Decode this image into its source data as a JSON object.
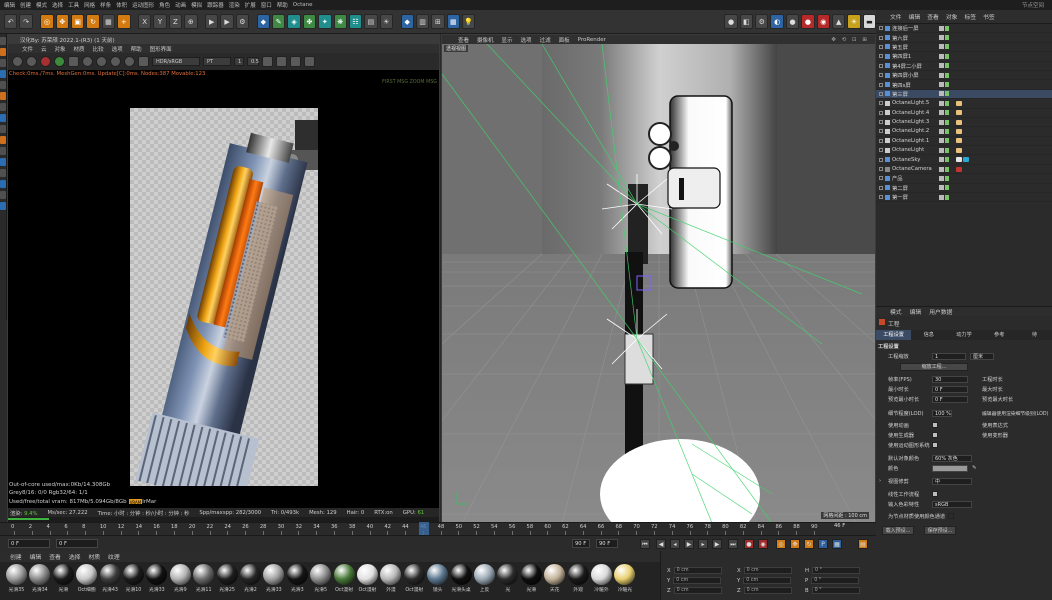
{
  "menubar": {
    "items": [
      "编辑",
      "创建",
      "模式",
      "选择",
      "工具",
      "网格",
      "样条",
      "体积",
      "运动图形",
      "角色",
      "动画",
      "模拟",
      "跟踪器",
      "渲染",
      "扩展",
      "窗口",
      "帮助",
      "Octane"
    ],
    "right": "节点空间"
  },
  "octane_viewer": {
    "title": "汉化By: 苏荣颀 2022.1-(R3) (1 天前)",
    "menu": [
      "文件",
      "云",
      "对象",
      "材质",
      "比较",
      "选项",
      "帮助",
      "图形界面"
    ],
    "color_space": "HDR/sRGB",
    "kernel": "PT",
    "value1": "1",
    "value2": "0.5",
    "status_line": "Check:0ms./7ms. MeshGen:0ms. Update[C]:0ms. Nodes:387 Movable:123",
    "status_right": "FIRST MSG ZOOM MSG",
    "info_lines": [
      "Out-of-core used/max:0Kb/14.308Gb",
      "Grey8/16: 0/0          Rgb32/64: 1/1",
      "Used/free/total vram: 817Mb/5.094Gb/8Gb"
    ],
    "info_badge": "VRAM",
    "info_tail": "lrMar",
    "bar": {
      "render_label": "渲染:",
      "render_pct": "9.4%",
      "ms_sec": "Ms/sec: 27.222",
      "time": "Time: 小时 : 分钟 : 秒/小时 : 分钟 : 秒",
      "spp": "Spp/maxspp: 282/3000",
      "tri": "Tri: 0/493k",
      "mesh": "Mesh: 129",
      "hair": "Hair: 0",
      "rtx": "RTX:on",
      "gpu": "GPU:",
      "gpu_val": "61"
    },
    "progress_fraction": 0.094
  },
  "viewport": {
    "menu": [
      "查看",
      "摄像机",
      "显示",
      "选项",
      "过滤",
      "面板",
      "ProRender"
    ],
    "label": "透视视图",
    "grid_label": "网格间距 : 100 cm",
    "nav": "✥ ⟲ ⊡ ⊞"
  },
  "object_manager": {
    "menu": [
      "文件",
      "编辑",
      "查看",
      "对象",
      "标签",
      "书签"
    ],
    "objects": [
      {
        "name": "连接后一屏",
        "icon": "null",
        "tag": "",
        "sel": false
      },
      {
        "name": "第六屏",
        "icon": "null",
        "tag": "",
        "sel": false
      },
      {
        "name": "第五屏",
        "icon": "null",
        "tag": "",
        "sel": false
      },
      {
        "name": "第四屏1",
        "icon": "null",
        "tag": "",
        "sel": false
      },
      {
        "name": "第4屏二小屏",
        "icon": "null",
        "tag": "",
        "sel": false
      },
      {
        "name": "第四屏小屏",
        "icon": "null",
        "tag": "",
        "sel": false
      },
      {
        "name": "第四s屏",
        "icon": "null",
        "tag": "",
        "sel": false
      },
      {
        "name": "第三屏",
        "icon": "null",
        "tag": "",
        "sel": true
      },
      {
        "name": "OctaneLight.5",
        "icon": "light",
        "tag": "light",
        "sel": false
      },
      {
        "name": "OctaneLight.4",
        "icon": "light",
        "tag": "light",
        "sel": false
      },
      {
        "name": "OctaneLight.3",
        "icon": "light",
        "tag": "light",
        "sel": false
      },
      {
        "name": "OctaneLight.2",
        "icon": "light",
        "tag": "light",
        "sel": false
      },
      {
        "name": "OctaneLight.1",
        "icon": "light",
        "tag": "light",
        "sel": false
      },
      {
        "name": "OctaneLight",
        "icon": "light",
        "tag": "light",
        "sel": false
      },
      {
        "name": "OctaneSky",
        "icon": "sky",
        "tag": "sky",
        "sel": false
      },
      {
        "name": "OctaneCamera",
        "icon": "cam",
        "tag": "cam",
        "sel": false
      },
      {
        "name": "产品",
        "icon": "null",
        "tag": "",
        "sel": false
      },
      {
        "name": "第二屏",
        "icon": "null",
        "tag": "",
        "sel": false
      },
      {
        "name": "第一屏",
        "icon": "null",
        "tag": "",
        "sel": false
      }
    ]
  },
  "attributes": {
    "menu": [
      "模式",
      "编辑",
      "用户数据"
    ],
    "header": "工程",
    "tabs": [
      "工程设置",
      "信息",
      "动力学",
      "参考",
      "待"
    ],
    "section": "工程设置",
    "scale_label": "工程缩放",
    "scale_value": "1",
    "scale_unit": "厘米",
    "scale_button": "缩放工程...",
    "fps_label": "帧率(FPS)",
    "fps_value": "30",
    "project_time_label": "工程时长",
    "min_time_label": "最小时长",
    "min_time_value": "0 F",
    "max_time_label": "最大时长",
    "preview_min_label": "预览最小时长",
    "preview_min_value": "0 F",
    "preview_max_label": "预览最大时长",
    "lod_label": "细节程度(LOD)",
    "lod_value": "100 %",
    "lod_note": "编辑器使用渲染细节级别(LOD)",
    "use_anim": "使用动画",
    "use_expr": "使用表达式",
    "use_gen": "使用生成器",
    "use_deform": "使用变形器",
    "use_motion": "使用运动图形系统",
    "default_color_label": "默认对象颜色",
    "default_color_value": "60% 灰色",
    "color_label": "颜色",
    "view_clip": "视图修剪",
    "view_clip_value": "中",
    "linear": "线性工作流程",
    "input_color": "输入色彩特性",
    "input_color_value": "sRGB",
    "vertex_color": "为节点材质使用颜色通道",
    "load_preset": "载入预设...",
    "save_preset": "保存预设..."
  },
  "timeline": {
    "ticks": [
      "0",
      "2",
      "4",
      "6",
      "8",
      "10",
      "12",
      "14",
      "16",
      "18",
      "20",
      "22",
      "24",
      "26",
      "28",
      "30",
      "32",
      "34",
      "36",
      "38",
      "40",
      "42",
      "44",
      "46",
      "48",
      "50",
      "52",
      "54",
      "56",
      "58",
      "60",
      "62",
      "64",
      "66",
      "68",
      "70",
      "72",
      "74",
      "76",
      "78",
      "80",
      "82",
      "84",
      "86",
      "88",
      "90"
    ],
    "current_frame": "46",
    "end_frame_label": "46 F"
  },
  "transport": {
    "start": "0 F",
    "current": "0 F",
    "end": "90 F",
    "end2": "90 F"
  },
  "materials": {
    "menu": [
      "创建",
      "编辑",
      "查看",
      "选择",
      "材质",
      "纹理"
    ],
    "items": [
      {
        "name": "光滑35",
        "color": "#9a9a9a"
      },
      {
        "name": "光滑34",
        "color": "#8a8a8a"
      },
      {
        "name": "光滑",
        "color": "#1a1a1a"
      },
      {
        "name": "Oct细胞",
        "color": "#c8c8c8"
      },
      {
        "name": "光滑43",
        "color": "#3d3d3d"
      },
      {
        "name": "光滑10",
        "color": "#1c1c1c"
      },
      {
        "name": "光滑33",
        "color": "#111111"
      },
      {
        "name": "光滑9",
        "color": "#b3b3b3"
      },
      {
        "name": "光滑11",
        "color": "#6c6c6c"
      },
      {
        "name": "光滑25",
        "color": "#1e1e1e"
      },
      {
        "name": "光滑2",
        "color": "#252525"
      },
      {
        "name": "光滑33",
        "color": "#a3a3a3"
      },
      {
        "name": "光滑3",
        "color": "#151515"
      },
      {
        "name": "光滑5",
        "color": "#8f8f8f"
      },
      {
        "name": "Oct漫射",
        "color": "#4a7a3a"
      },
      {
        "name": "Oct漫射",
        "color": "#e0e0e0"
      },
      {
        "name": "外漫",
        "color": "#b8b8b8"
      },
      {
        "name": "Oct漫射",
        "color": "#2a2a2a"
      },
      {
        "name": "镜头",
        "color": "#5d7890"
      },
      {
        "name": "光滑头桌",
        "color": "#101010"
      },
      {
        "name": "上反",
        "color": "#9aa9b5"
      },
      {
        "name": "光",
        "color": "#2c2c2c"
      },
      {
        "name": "光滑",
        "color": "#0e0e0e"
      },
      {
        "name": "天花",
        "color": "#c4b39a"
      },
      {
        "name": "外观",
        "color": "#1a1a1a"
      },
      {
        "name": "冷暖外",
        "color": "#d9d9d9"
      },
      {
        "name": "冷暖光",
        "color": "#e8d070"
      }
    ]
  },
  "coords": {
    "x_label": "X",
    "y_label": "Y",
    "z_label": "Z",
    "x_val": "0 cm",
    "y_val": "0 cm",
    "z_val": "0 cm",
    "x2_label": "X",
    "y2_label": "Y",
    "z2_label": "Z",
    "x2_val": "0 cm",
    "y2_val": "0 cm",
    "z2_val": "0 cm",
    "h_label": "H",
    "p_label": "P",
    "b_label": "B",
    "h_val": "0 °",
    "p_val": "0 °",
    "b_val": "0 °"
  }
}
